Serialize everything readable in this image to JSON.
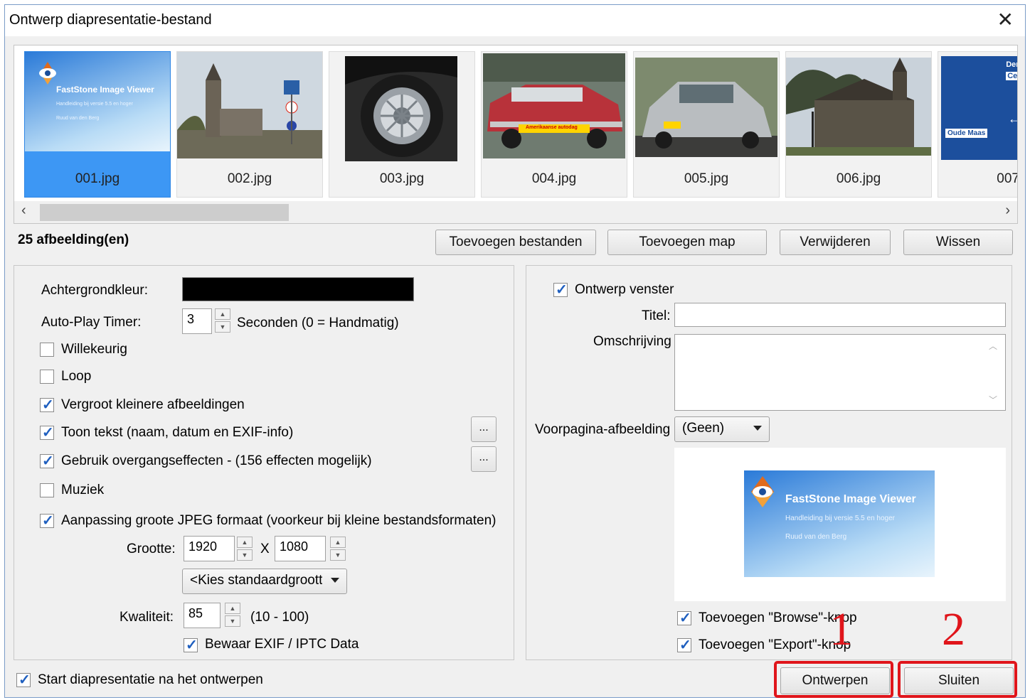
{
  "window": {
    "title": "Ontwerp diapresentatie-bestand",
    "close_glyph": "✕"
  },
  "thumbnails": [
    {
      "label": "001.jpg",
      "selected": true,
      "fs_title": "FastStone Image Viewer",
      "fs_sub1": "Handleiding bij versie 5.5 en hoger",
      "fs_sub2": "Ruud van den Berg"
    },
    {
      "label": "002.jpg",
      "selected": false
    },
    {
      "label": "003.jpg",
      "selected": false
    },
    {
      "label": "004.jpg",
      "selected": false,
      "banner": "Amerikaanse autodag"
    },
    {
      "label": "005.jpg",
      "selected": false
    },
    {
      "label": "006.jpg",
      "selected": false
    },
    {
      "label": "007",
      "selected": false,
      "sign1": "Den",
      "sign2": "Cen",
      "sign3": "Oude Maas"
    }
  ],
  "scroll": {
    "left": "‹",
    "right": "›"
  },
  "image_count": "25 afbeelding(en)",
  "toolbar": {
    "add_files": "Toevoegen bestanden",
    "add_folder": "Toevoegen map",
    "remove": "Verwijderen",
    "clear": "Wissen"
  },
  "left": {
    "bg_label": "Achtergrondkleur:",
    "bg_color": "#000000",
    "timer_label": "Auto-Play Timer:",
    "timer_value": "3",
    "timer_unit": "Seconden (0 = Handmatig)",
    "random": "Willekeurig",
    "loop": "Loop",
    "enlarge": "Vergroot kleinere afbeeldingen",
    "show_text": "Toon tekst (naam, datum en EXIF-info)",
    "transitions": "Gebruik overgangseffecten - (156 effecten mogelijk)",
    "music": "Muziek",
    "jpeg_resize": "Aanpassing groote JPEG formaat (voorkeur bij kleine bestandsformaten)",
    "ellipsis": "...",
    "size_label": "Grootte:",
    "width": "1920",
    "height": "1080",
    "x": "X",
    "preset": "<Kies standaardgrootte",
    "quality_label": "Kwaliteit:",
    "quality": "85",
    "quality_range": "(10 - 100)",
    "keep_exif": "Bewaar EXIF / IPTC Data"
  },
  "right": {
    "design_window": "Ontwerp venster",
    "title_label": "Titel:",
    "title_value": "",
    "desc_label": "Omschrijving",
    "desc_value": "",
    "cover_label": "Voorpagina-afbeelding",
    "cover_value": "(Geen)",
    "preview_title": "FastStone Image Viewer",
    "preview_sub1": "Handleiding bij versie 5.5 en hoger",
    "preview_sub2": "Ruud van den Berg",
    "add_browse": "Toevoegen \"Browse\"-knop",
    "add_export": "Toevoegen \"Export\"-knop"
  },
  "footer": {
    "start_after": "Start diapresentatie na het ontwerpen",
    "design_btn": "Ontwerpen",
    "close_btn": "Sluiten"
  },
  "annotations": {
    "one": "1",
    "two": "2",
    "color": "#e0151b"
  }
}
